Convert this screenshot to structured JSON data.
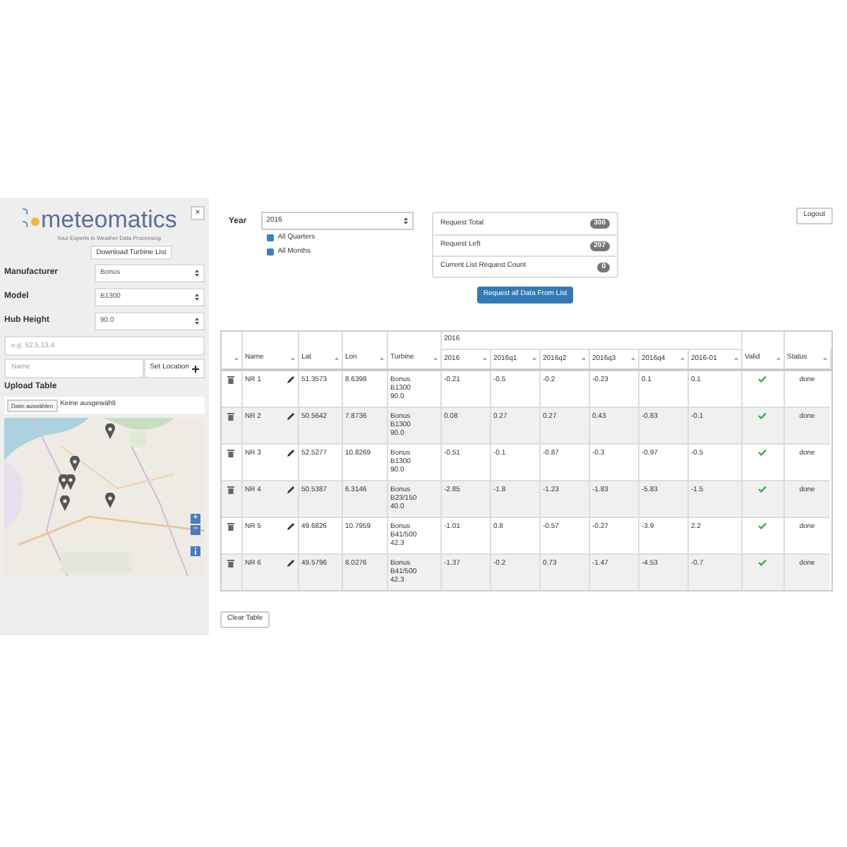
{
  "sidebar": {
    "logo": "meteomatics",
    "tagline": "Your Experts in Weather Data Processing",
    "close": "×",
    "download_button": "Download Turbine List",
    "selects": [
      {
        "label": "Manufacturer",
        "value": "Bonus"
      },
      {
        "label": "Model",
        "value": "B1300"
      },
      {
        "label": "Hub Height",
        "value": "90.0"
      }
    ],
    "coordinates": {
      "placeholder": "e.g. 52.5,13.4"
    },
    "name_field": {
      "placeholder": "Name"
    },
    "set_location_button": "Set Location",
    "upload_label": "Upload Table",
    "file_button": "Datei auswählen",
    "file_status": "Keine ausgewählt",
    "map": {
      "kind": "picture",
      "zoom_in": "+",
      "zoom_out": "−"
    }
  },
  "main": {
    "year_label": "Year",
    "year": "2016",
    "checkboxes": [
      {
        "label": "All Quarters",
        "checked": true
      },
      {
        "label": "All Months",
        "checked": true
      }
    ],
    "stats": [
      {
        "label": "Request Total",
        "count": "300"
      },
      {
        "label": "Request Left",
        "count": "207"
      },
      {
        "label": "Current List Request Count",
        "count": "0"
      }
    ],
    "request_button": "Request all Data From List",
    "logout_button": "Logout",
    "table": {
      "group_header": "2016",
      "columns": [
        "Name",
        "Lat",
        "Lon",
        "Turbine",
        "2016",
        "2016q1",
        "2016q2",
        "2016q3",
        "2016q4",
        "2016-01",
        "Valid",
        "Status"
      ],
      "rows": [
        {
          "name": "NR 1",
          "lat": "51.3573",
          "lon": "8.6398",
          "turbine": [
            "Bonus",
            "B1300",
            "90.0"
          ],
          "values": [
            "-0.21",
            "-0.5",
            "-0.2",
            "-0.23",
            "0.1",
            "0.1"
          ],
          "valid": true,
          "status": "done"
        },
        {
          "name": "NR 2",
          "lat": "50.5642",
          "lon": "7.8736",
          "turbine": [
            "Bonus",
            "B1300",
            "90.0"
          ],
          "values": [
            "0.08",
            "0.27",
            "0.27",
            "0.43",
            "-0.83",
            "-0.1"
          ],
          "valid": true,
          "status": "done"
        },
        {
          "name": "NR 3",
          "lat": "52.5277",
          "lon": "10.8269",
          "turbine": [
            "Bonus",
            "B1300",
            "90.0"
          ],
          "values": [
            "-0.51",
            "-0.1",
            "-0.87",
            "-0.3",
            "-0.97",
            "-0.5"
          ],
          "valid": true,
          "status": "done"
        },
        {
          "name": "NR 4",
          "lat": "50.5387",
          "lon": "6.3146",
          "turbine": [
            "Bonus",
            "B23/150",
            "40.0"
          ],
          "values": [
            "-2.85",
            "-1.8",
            "-1.23",
            "-1.83",
            "-5.83",
            "-1.5"
          ],
          "valid": true,
          "status": "done"
        },
        {
          "name": "NR 5",
          "lat": "49.6826",
          "lon": "10.7959",
          "turbine": [
            "Bonus",
            "B41/500",
            "42.3"
          ],
          "values": [
            "-1.01",
            "0.8",
            "-0.57",
            "-0.27",
            "-3.9",
            "2.2"
          ],
          "valid": true,
          "status": "done"
        },
        {
          "name": "NR 6",
          "lat": "49.5796",
          "lon": "8.0276",
          "turbine": [
            "Bonus",
            "B41/500",
            "42.3"
          ],
          "values": [
            "-1.37",
            "-0.2",
            "0.73",
            "-1.47",
            "-4.53",
            "-0.7"
          ],
          "valid": true,
          "status": "done"
        }
      ]
    },
    "clear_button": "Clear Table"
  }
}
